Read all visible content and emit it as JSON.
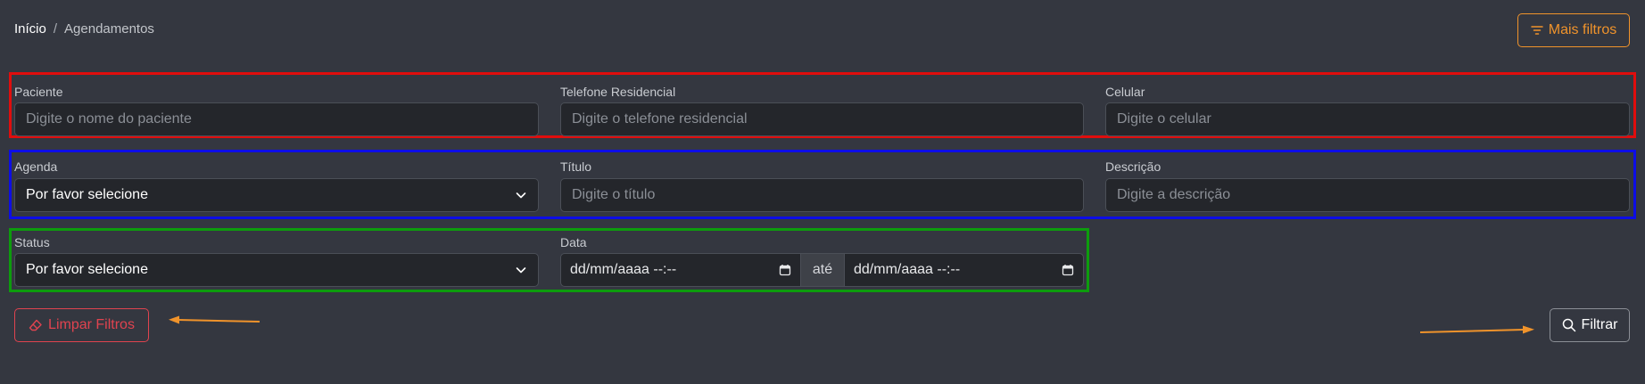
{
  "breadcrumb": {
    "home": "Início",
    "separator": "/",
    "current": "Agendamentos"
  },
  "header": {
    "more_filters_label": "Mais filtros",
    "more_filters_icon": "filter-lines-icon"
  },
  "row1": {
    "paciente_label": "Paciente",
    "paciente_placeholder": "Digite o nome do paciente",
    "telefone_label": "Telefone Residencial",
    "telefone_placeholder": "Digite o telefone residencial",
    "celular_label": "Celular",
    "celular_placeholder": "Digite o celular"
  },
  "row2": {
    "agenda_label": "Agenda",
    "agenda_value": "Por favor selecione",
    "titulo_label": "Título",
    "titulo_placeholder": "Digite o título",
    "descricao_label": "Descrição",
    "descricao_placeholder": "Digite a descrição"
  },
  "row3": {
    "status_label": "Status",
    "status_value": "Por favor selecione",
    "data_label": "Data",
    "data_from": "dd/mm/aaaa --:--",
    "data_connector": "até",
    "data_to": "dd/mm/aaaa --:--"
  },
  "actions": {
    "clear_label": "Limpar Filtros",
    "filter_label": "Filtrar"
  },
  "colors": {
    "accent_orange": "#f0932b",
    "danger": "#e0434f",
    "outline_red": "#e00d0d",
    "outline_blue": "#0d0de6",
    "outline_green": "#0d9c0d"
  }
}
